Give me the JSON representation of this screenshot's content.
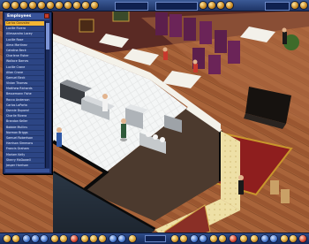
{
  "hud_top": {
    "field_left": "",
    "field_mid": "",
    "field_right": ""
  },
  "staff_panel": {
    "title": "Employees",
    "rows": [
      "Carlos Gonzalez",
      "Lucille Rivera",
      "Allessandro Lacey",
      "Lucille Rose",
      "Alma Martinez",
      "Catalina Beck",
      "Charlene Fisher",
      "Wallace Barnes",
      "Lucille Crane",
      "Allan Crane",
      "Samuel Beck",
      "Vivian Thomas",
      "Matthew Richards",
      "Bessemann Fishe",
      "Rocco Anderson",
      "Carlos LaPorta",
      "Donnie Dupond",
      "Charlie Rivera",
      "Brandon Keller",
      "Bobbie Mullins",
      "Norman Briggs",
      "Samuel Robertson",
      "Harrison Simmons",
      "Francis Graham",
      "Mariam Kelly",
      "Sherry McDowell",
      "Jasper Harrison",
      "Fred Simmons",
      "Matthew Crane",
      "Raymond Lacey",
      "Napoleon Jenkins",
      "Samuel Lacey",
      "Norman Jensen",
      "Marjorie Gray"
    ],
    "selected_index": 0
  },
  "hud_bottom": {
    "readout": ""
  },
  "colors": {
    "hud_blue": "#1e3466",
    "panel_blue": "#22356e",
    "selected_row": "#f3b634"
  }
}
